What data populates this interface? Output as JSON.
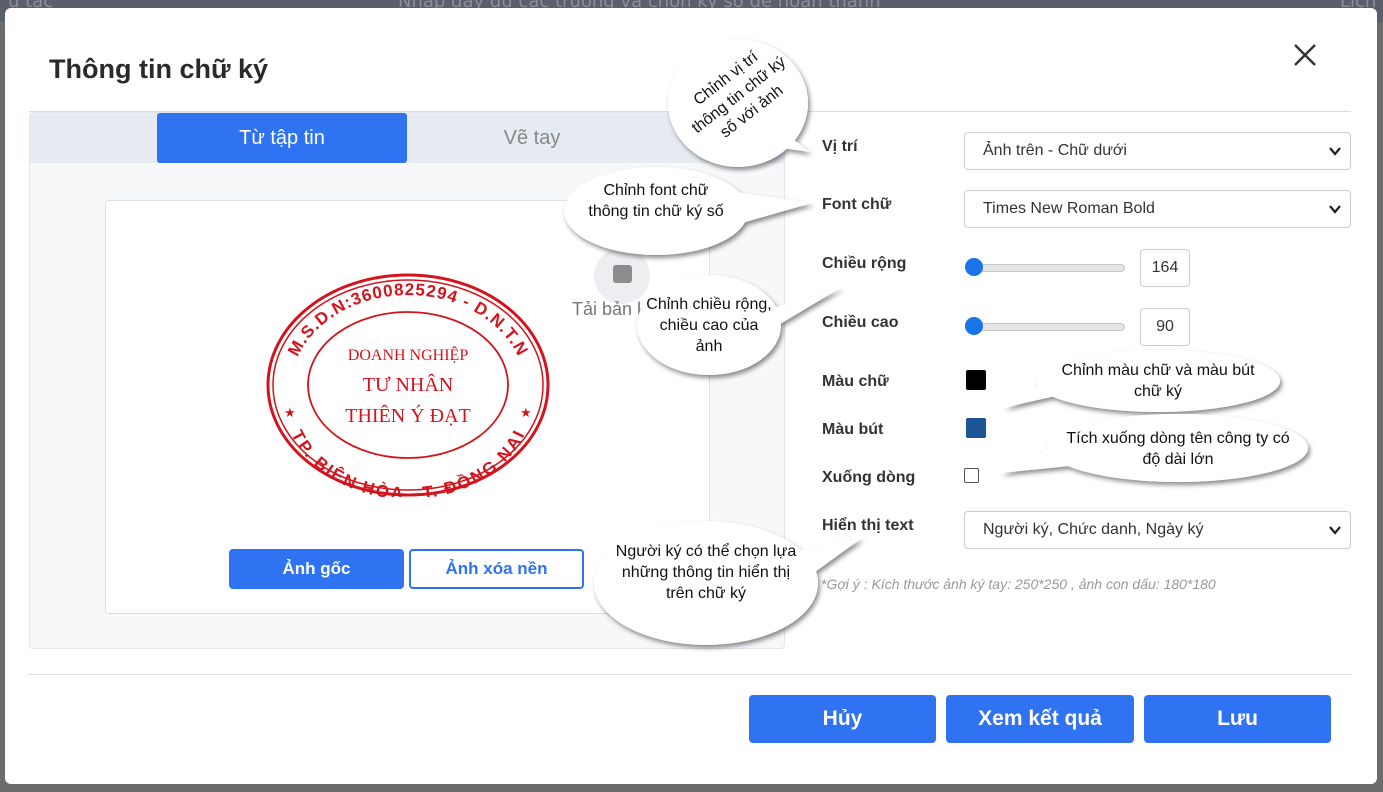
{
  "background": {
    "left_text": "ự tác",
    "center_text": "Nhập đầy đủ các trường và chọn ký số để hoàn thành",
    "right_text": "Lịch"
  },
  "modal": {
    "title": "Thông tin chữ ký",
    "close_label": "×"
  },
  "tabs": [
    {
      "label": "Từ tập tin",
      "active": true
    },
    {
      "label": "Vẽ tay",
      "active": false
    }
  ],
  "upload": {
    "text": "Tải bản k"
  },
  "stamp": {
    "outer_top": "M.S.D.N:3600825294 - D.N.T.N",
    "outer_bottom": "TP. BIÊN HÒA - T. ĐỒNG NAI",
    "line1": "DOANH NGHIỆP",
    "line2": "TƯ NHÂN",
    "line3": "THIÊN Ý ĐẠT",
    "color": "#d4141c"
  },
  "image_buttons": {
    "original": "Ảnh gốc",
    "remove_bg": "Ảnh xóa nền"
  },
  "form": {
    "position": {
      "label": "Vị trí",
      "value": "Ảnh trên - Chữ dưới"
    },
    "font": {
      "label": "Font chữ",
      "value": "Times New Roman Bold"
    },
    "width": {
      "label": "Chiều rộng",
      "value": "164",
      "slider_fraction": 0.0
    },
    "height": {
      "label": "Chiều cao",
      "value": "90",
      "slider_fraction": 0.0
    },
    "text_color": {
      "label": "Màu chữ",
      "color": "#000000"
    },
    "pen_color": {
      "label": "Màu bút",
      "color": "#1c5596"
    },
    "line_break": {
      "label": "Xuống dòng",
      "checked": false
    },
    "display_text": {
      "label": "Hiển thị text",
      "value": "Người ký, Chức danh, Ngày ký"
    },
    "hint": "*Gợi ý : Kích thước ảnh ký tay: 250*250 , ảnh con dấu: 180*180"
  },
  "callouts": {
    "position": "Chỉnh vị trí thông tin chữ ký số với ảnh",
    "font": "Chỉnh font chữ thông tin chữ ký số",
    "size": "Chỉnh chiều rộng, chiều cao của ảnh",
    "color": "Chỉnh màu chữ và màu bút chữ ký",
    "line_break": "Tích xuống dòng tên công ty có độ dài lớn",
    "display": "Người ký có thể chọn lựa những thông tin hiển thị trên chữ ký"
  },
  "footer": {
    "cancel": "Hủy",
    "preview": "Xem kết quả",
    "save": "Lưu"
  }
}
